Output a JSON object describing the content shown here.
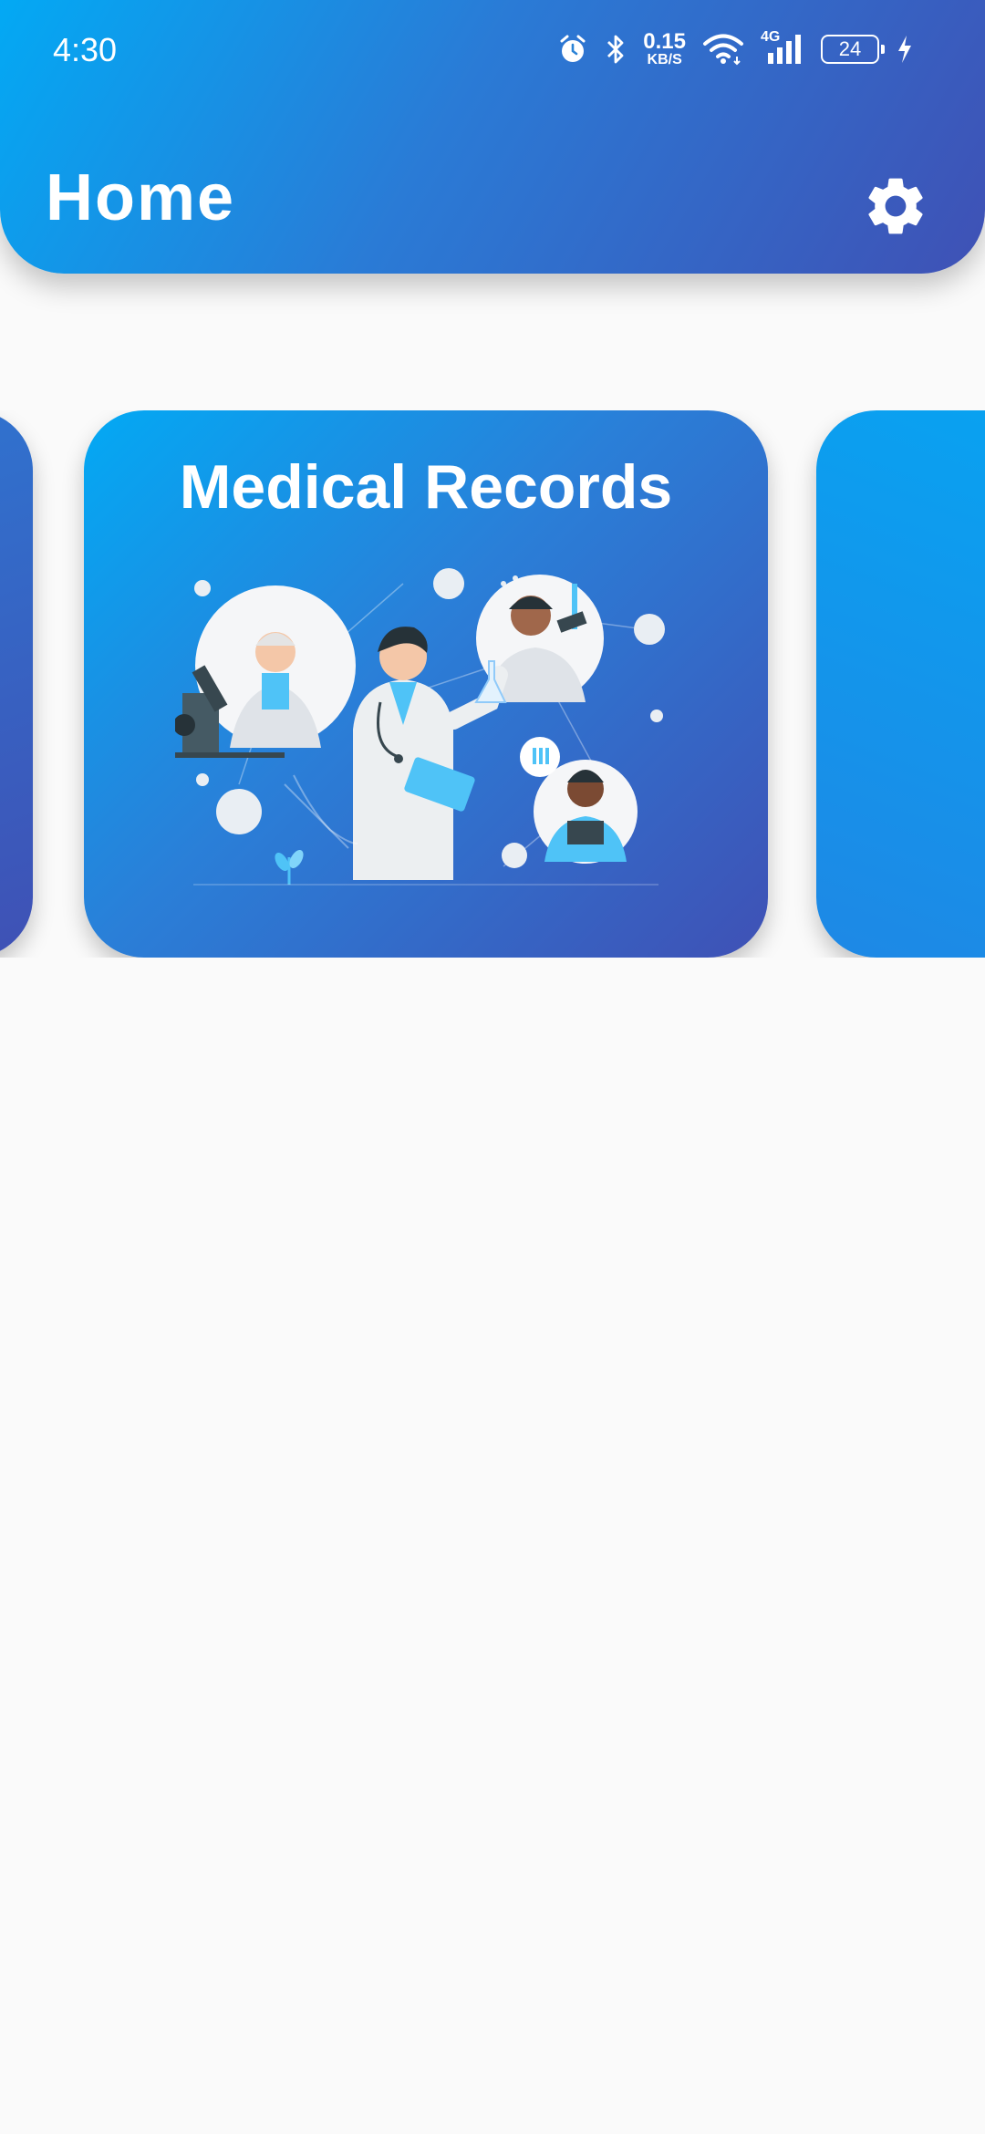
{
  "status_bar": {
    "time": "4:30",
    "net_speed_value": "0.15",
    "net_speed_unit": "KB/S",
    "network_type": "4G",
    "battery_level": "24",
    "icons": [
      "alarm-icon",
      "bluetooth-icon",
      "wifi-icon",
      "signal-icon",
      "battery-icon",
      "charging-icon"
    ]
  },
  "header": {
    "title": "Home",
    "settings_icon": "gear-icon"
  },
  "carousel": {
    "cards": [
      {
        "title": ""
      },
      {
        "title": "Medical Records",
        "image": "medical-staff-illustration"
      },
      {
        "title": ""
      }
    ]
  },
  "colors": {
    "gradient_start": "#03a9f4",
    "gradient_end": "#3f51b5",
    "background": "#fafafa",
    "text": "#ffffff"
  }
}
